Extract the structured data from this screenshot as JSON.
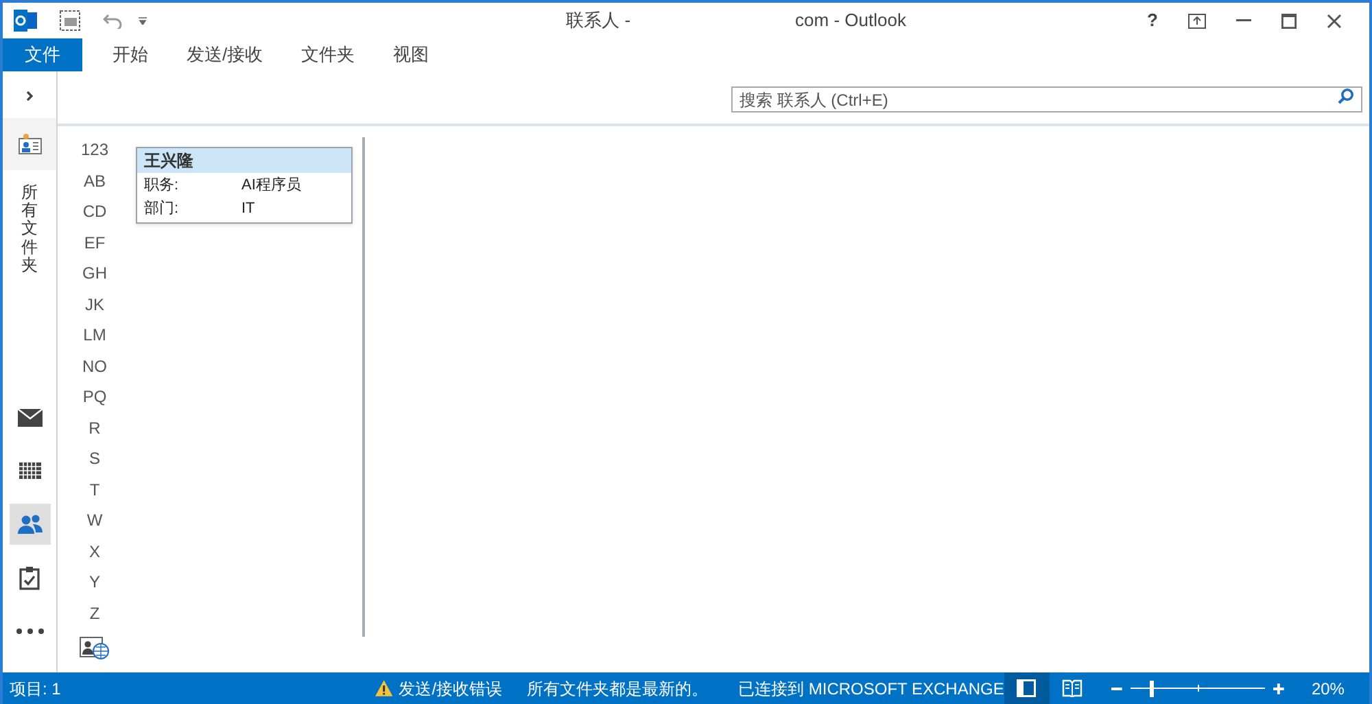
{
  "window": {
    "title_left": "联系人 -",
    "title_right": "com - Outlook",
    "help": "?"
  },
  "ribbon_tabs": [
    {
      "label": "文件",
      "selected": true
    },
    {
      "label": "开始",
      "selected": false
    },
    {
      "label": "发送/接收",
      "selected": false
    },
    {
      "label": "文件夹",
      "selected": false
    },
    {
      "label": "视图",
      "selected": false
    }
  ],
  "nav": {
    "folder_label": "所有文件夹",
    "modules": [
      {
        "kind": "mail",
        "selected": false
      },
      {
        "kind": "calendar",
        "selected": false
      },
      {
        "kind": "people",
        "selected": true
      },
      {
        "kind": "tasks",
        "selected": false
      },
      {
        "kind": "more",
        "selected": false
      }
    ]
  },
  "search": {
    "placeholder": "搜索 联系人 (Ctrl+E)"
  },
  "index": [
    "123",
    "AB",
    "CD",
    "EF",
    "GH",
    "JK",
    "LM",
    "NO",
    "PQ",
    "R",
    "S",
    "T",
    "W",
    "X",
    "Y",
    "Z"
  ],
  "contacts": [
    {
      "name": "王兴隆",
      "selected": true,
      "fields": [
        {
          "label": "职务:",
          "value": "AI程序员"
        },
        {
          "label": "部门:",
          "value": "IT"
        }
      ]
    }
  ],
  "status_bar": {
    "items": "项目: 1",
    "error": "发送/接收错误",
    "sync": "所有文件夹都是最新的。",
    "connection": "已连接到 MICROSOFT EXCHANGE",
    "views": [
      {
        "kind": "normal",
        "selected": true
      },
      {
        "kind": "reading",
        "selected": false
      }
    ],
    "zoom": {
      "level": 0.15,
      "reading": "20%"
    }
  }
}
